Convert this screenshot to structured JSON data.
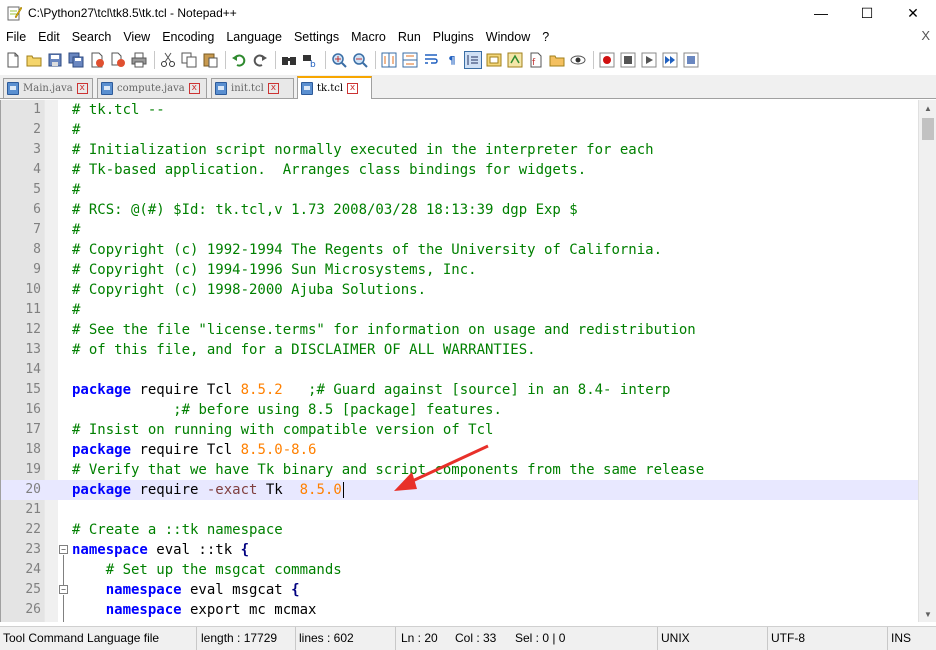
{
  "window": {
    "title": "C:\\Python27\\tcl\\tk8.5\\tk.tcl - Notepad++",
    "minimize": "—",
    "maximize": "☐",
    "close": "✕"
  },
  "menu": {
    "items": [
      "File",
      "Edit",
      "Search",
      "View",
      "Encoding",
      "Language",
      "Settings",
      "Macro",
      "Run",
      "Plugins",
      "Window",
      "?"
    ],
    "close_doc": "X"
  },
  "tabs": [
    {
      "label": "Main.java",
      "active": false
    },
    {
      "label": "compute.java",
      "active": false
    },
    {
      "label": "init.tcl",
      "active": false
    },
    {
      "label": "tk.tcl",
      "active": true
    }
  ],
  "editor": {
    "current_line": 20,
    "lines": [
      {
        "n": "1",
        "segs": [
          {
            "t": "# tk.tcl --",
            "c": "comment"
          }
        ]
      },
      {
        "n": "2",
        "segs": [
          {
            "t": "#",
            "c": "comment"
          }
        ]
      },
      {
        "n": "3",
        "segs": [
          {
            "t": "# Initialization script normally executed in the interpreter for each",
            "c": "comment"
          }
        ]
      },
      {
        "n": "4",
        "segs": [
          {
            "t": "# Tk-based application.  Arranges class bindings for widgets.",
            "c": "comment"
          }
        ]
      },
      {
        "n": "5",
        "segs": [
          {
            "t": "#",
            "c": "comment"
          }
        ]
      },
      {
        "n": "6",
        "segs": [
          {
            "t": "# RCS: @(#) $Id: tk.tcl,v 1.73 2008/03/28 18:13:39 dgp Exp $",
            "c": "comment"
          }
        ]
      },
      {
        "n": "7",
        "segs": [
          {
            "t": "#",
            "c": "comment"
          }
        ]
      },
      {
        "n": "8",
        "segs": [
          {
            "t": "# Copyright (c) 1992-1994 The Regents of the University of California.",
            "c": "comment"
          }
        ]
      },
      {
        "n": "9",
        "segs": [
          {
            "t": "# Copyright (c) 1994-1996 Sun Microsystems, Inc.",
            "c": "comment"
          }
        ]
      },
      {
        "n": "10",
        "segs": [
          {
            "t": "# Copyright (c) 1998-2000 Ajuba Solutions.",
            "c": "comment"
          }
        ]
      },
      {
        "n": "11",
        "segs": [
          {
            "t": "#",
            "c": "comment"
          }
        ]
      },
      {
        "n": "12",
        "segs": [
          {
            "t": "# See the file \"license.terms\" for information on usage and redistribution",
            "c": "comment"
          }
        ]
      },
      {
        "n": "13",
        "segs": [
          {
            "t": "# of this file, and for a DISCLAIMER OF ALL WARRANTIES.",
            "c": "comment"
          }
        ]
      },
      {
        "n": "14",
        "segs": []
      },
      {
        "n": "15",
        "segs": [
          {
            "t": "package",
            "c": "kw"
          },
          {
            "t": " require Tcl ",
            "c": ""
          },
          {
            "t": "8.5.2",
            "c": "num"
          },
          {
            "t": "   ",
            "c": ""
          },
          {
            "t": ";# Guard against [source] in an 8.4- interp",
            "c": "comment"
          }
        ]
      },
      {
        "n": "16",
        "segs": [
          {
            "t": "            ",
            "c": ""
          },
          {
            "t": ";# before using 8.5 [package] features.",
            "c": "comment"
          }
        ]
      },
      {
        "n": "17",
        "segs": [
          {
            "t": "# Insist on running with compatible version of Tcl",
            "c": "comment"
          }
        ]
      },
      {
        "n": "18",
        "segs": [
          {
            "t": "package",
            "c": "kw"
          },
          {
            "t": " require Tcl ",
            "c": ""
          },
          {
            "t": "8.5.0-8.6",
            "c": "num"
          }
        ]
      },
      {
        "n": "19",
        "segs": [
          {
            "t": "# Verify that we have Tk binary and script components from the same release",
            "c": "comment"
          }
        ]
      },
      {
        "n": "20",
        "segs": [
          {
            "t": "package",
            "c": "kw"
          },
          {
            "t": " require ",
            "c": ""
          },
          {
            "t": "-exact",
            "c": "opt"
          },
          {
            "t": " Tk  ",
            "c": ""
          },
          {
            "t": "8.5.0",
            "c": "num"
          }
        ]
      },
      {
        "n": "21",
        "segs": []
      },
      {
        "n": "22",
        "segs": [
          {
            "t": "# Create a ::tk namespace",
            "c": "comment"
          }
        ]
      },
      {
        "n": "23",
        "segs": [
          {
            "t": "namespace",
            "c": "kw"
          },
          {
            "t": " eval ::tk ",
            "c": ""
          },
          {
            "t": "{",
            "c": "op"
          }
        ]
      },
      {
        "n": "24",
        "segs": [
          {
            "t": "    # Set up the msgcat commands",
            "c": "comment"
          }
        ]
      },
      {
        "n": "25",
        "segs": [
          {
            "t": "    ",
            "c": ""
          },
          {
            "t": "namespace",
            "c": "kw"
          },
          {
            "t": " eval msgcat ",
            "c": ""
          },
          {
            "t": "{",
            "c": "op"
          }
        ]
      },
      {
        "n": "26",
        "segs": [
          {
            "t": "    ",
            "c": ""
          },
          {
            "t": "namespace",
            "c": "kw"
          },
          {
            "t": " export mc mcmax",
            "c": ""
          }
        ]
      }
    ]
  },
  "statusbar": {
    "language": "Tool Command Language file",
    "length": "length : 17729",
    "lines": "lines : 602",
    "ln": "Ln : 20",
    "col": "Col : 33",
    "sel": "Sel : 0 | 0",
    "eol": "UNIX",
    "encoding": "UTF-8",
    "mode": "INS"
  },
  "colors": {
    "comment": "#008000",
    "keyword": "#0000ff",
    "number": "#ff8000",
    "current_line": "#e8e8ff",
    "annotation_arrow": "#e8302a"
  },
  "toolbar": {
    "icons": [
      "new-file-icon",
      "open-file-icon",
      "save-icon",
      "save-all-icon",
      "close-icon",
      "close-all-icon",
      "print-icon",
      "cut-icon",
      "copy-icon",
      "paste-icon",
      "undo-icon",
      "redo-icon",
      "find-icon",
      "replace-icon",
      "zoom-in-icon",
      "zoom-out-icon",
      "sync-vertical-icon",
      "sync-horizontal-icon",
      "word-wrap-icon",
      "show-all-chars-icon",
      "indent-guide-icon",
      "doc-map-icon",
      "function-list-icon",
      "folder-workspace-icon",
      "monitoring-icon",
      "record-macro-icon",
      "stop-macro-icon",
      "play-macro-icon",
      "run-macro-multiple-icon",
      "save-macro-icon"
    ]
  }
}
